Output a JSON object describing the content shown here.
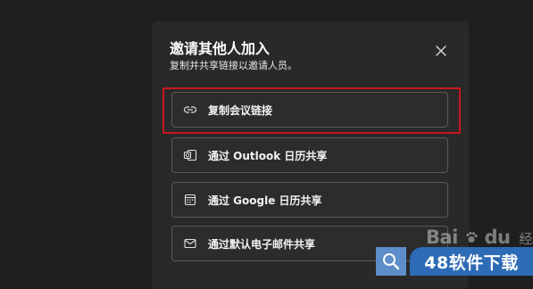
{
  "dialog": {
    "title": "邀请其他人加入",
    "subtitle": "复制并共享链接以邀请人员。",
    "close_icon": "close-icon"
  },
  "options": [
    {
      "label": "复制会议链接",
      "icon": "link-icon"
    },
    {
      "label": "通过 Outlook 日历共享",
      "icon": "outlook-icon"
    },
    {
      "label": "通过 Google 日历共享",
      "icon": "calendar-icon"
    },
    {
      "label": "通过默认电子邮件共享",
      "icon": "mail-icon"
    }
  ],
  "highlight_color": "#c8161d",
  "watermarks": {
    "baidu_text": "Bai",
    "baidu_paw": "du",
    "baidu_jingyan": "经验",
    "site_text": "48软件下载"
  }
}
